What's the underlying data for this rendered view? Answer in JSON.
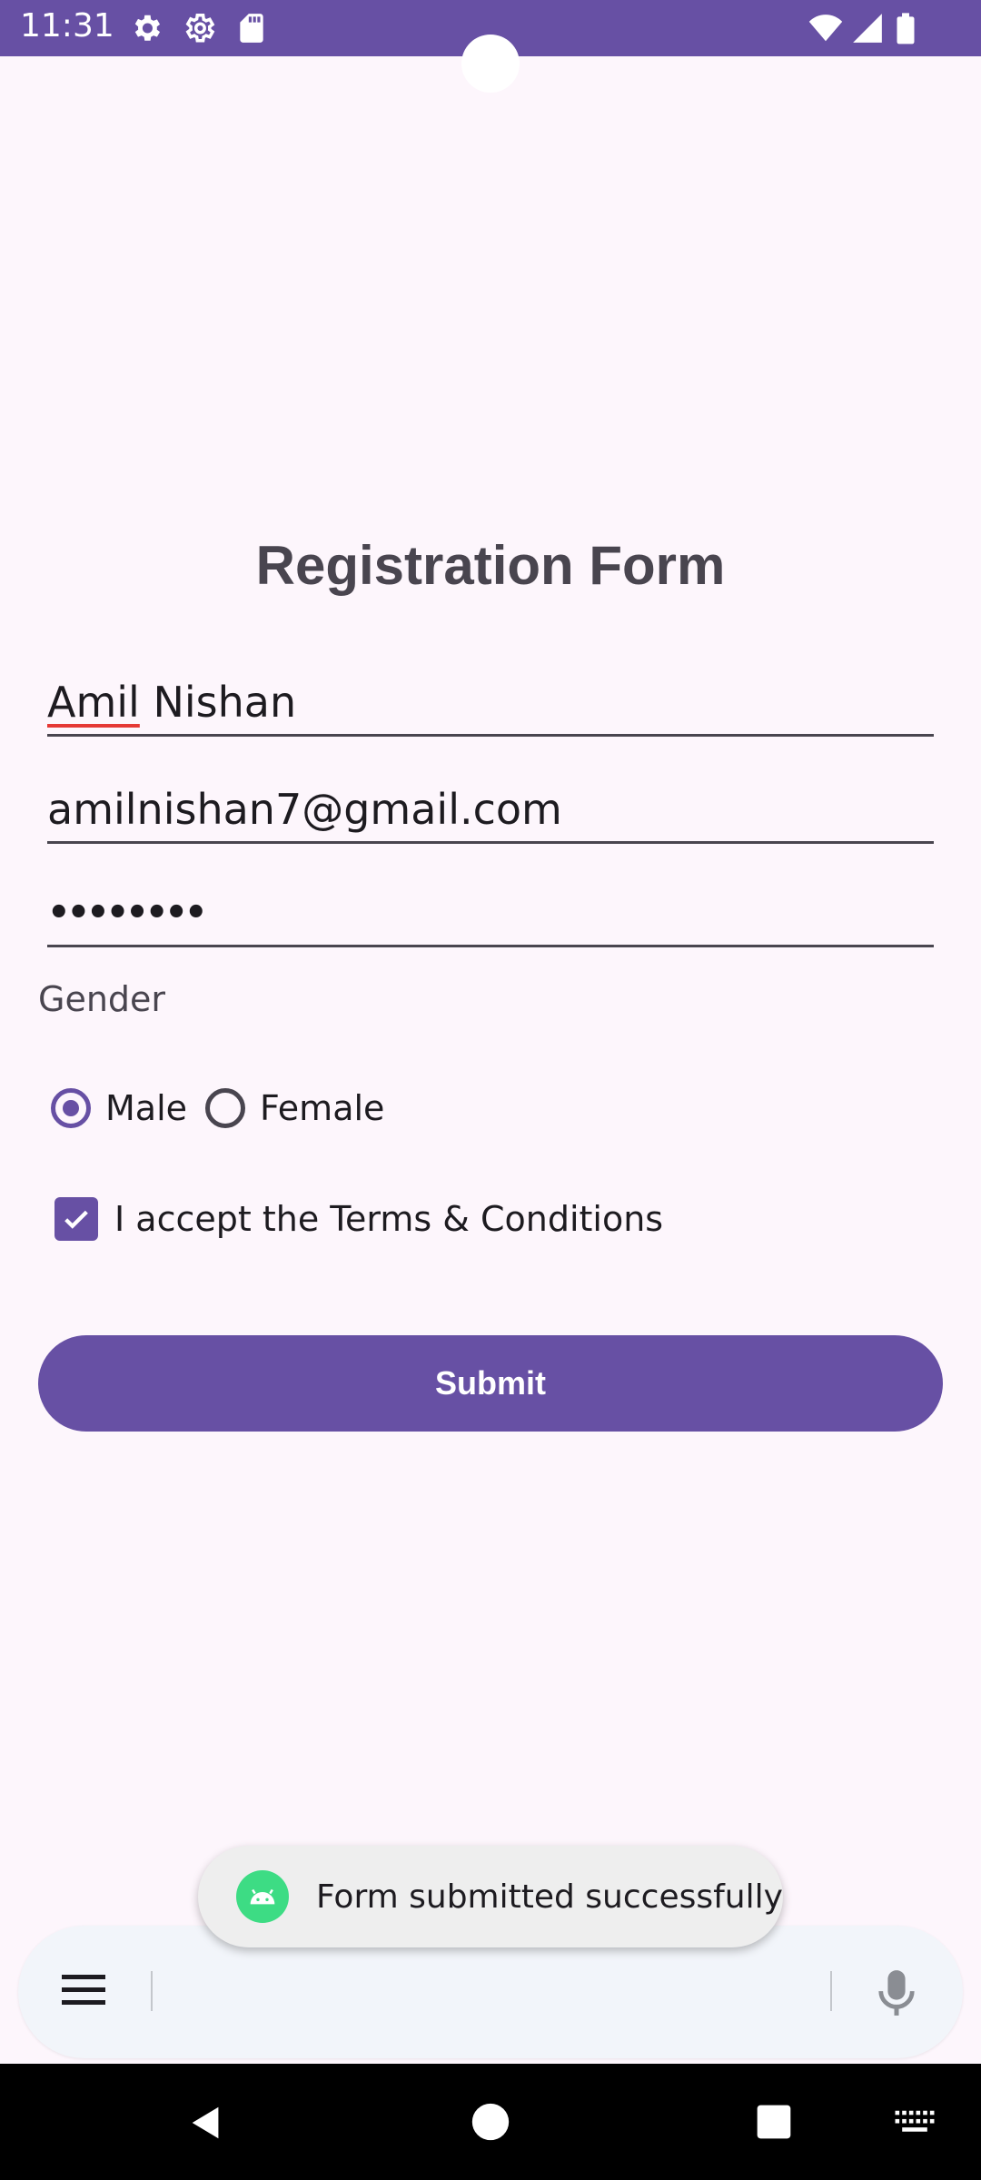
{
  "status_bar": {
    "time": "11:31",
    "left_icons": [
      "settings-icon",
      "settings-outline-icon",
      "sd-card-icon"
    ],
    "right_icons": [
      "wifi-icon",
      "signal-icon",
      "battery-icon"
    ],
    "color": "#6750a4"
  },
  "form": {
    "title": "Registration Form",
    "name": {
      "value_underlined": "Amil",
      "value_rest": " Nishan"
    },
    "email": {
      "value": "amilnishan7@gmail.com"
    },
    "password": {
      "value": "••••••••"
    },
    "gender_label": "Gender",
    "gender_options": [
      {
        "label": "Male",
        "selected": true
      },
      {
        "label": "Female",
        "selected": false
      }
    ],
    "terms": {
      "label": "I accept the Terms & Conditions",
      "checked": true
    },
    "submit_label": "Submit"
  },
  "toast": {
    "message": "Form submitted successfully",
    "icon": "android-icon"
  },
  "keyboard_bar": {
    "menu_icon": "menu-icon",
    "mic_icon": "mic-icon"
  },
  "nav_bar": {
    "buttons": [
      "back-icon",
      "home-icon",
      "recents-icon",
      "keyboard-icon"
    ]
  },
  "colors": {
    "accent": "#6750a4",
    "background": "#fdf6fc",
    "toast_icon": "#3ddc84"
  }
}
